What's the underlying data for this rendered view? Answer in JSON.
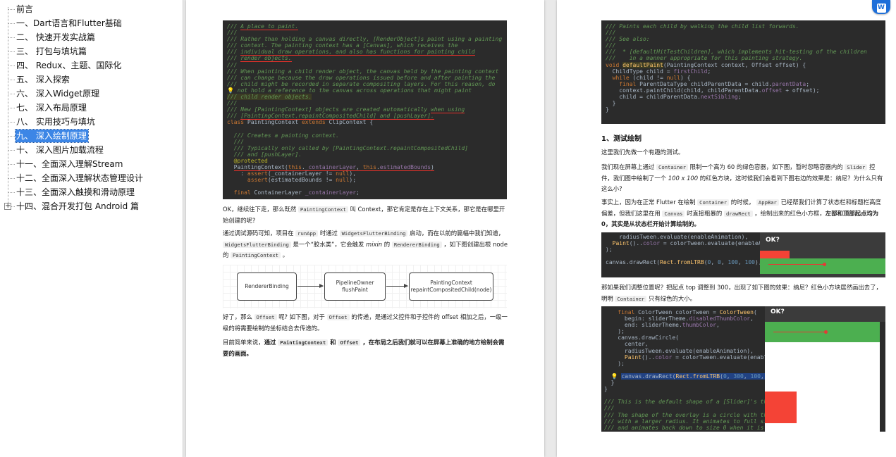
{
  "toc": {
    "items": [
      {
        "label": "前言"
      },
      {
        "label": "一、Dart语言和Flutter基础"
      },
      {
        "label": "二、 快速开发实战篇"
      },
      {
        "label": "三、 打包与填坑篇"
      },
      {
        "label": "四、 Redux、主题、国际化"
      },
      {
        "label": "五、 深入探索"
      },
      {
        "label": "六、 深入Widget原理"
      },
      {
        "label": "七、 深入布局原理"
      },
      {
        "label": "八、 实用技巧与填坑"
      },
      {
        "label": "九、 深入绘制原理"
      },
      {
        "label": "十、 深入图片加载流程"
      },
      {
        "label": "十一、全面深入理解Stream"
      },
      {
        "label": "十二、全面深入理解状态管理设计"
      },
      {
        "label": "十三、全面深入触摸和滑动原理"
      },
      {
        "label": "十四、混合开发打包 Android 篇"
      }
    ],
    "selected_index": 9,
    "expander_symbol": "+"
  },
  "page1": {
    "para1": {
      "a": "OK，继续往下走，那么既然",
      "code1": "PaintingContext",
      "b": "叫 Context，那它肯定是存在上下文关系，那它是在哪里开始创建的呢?"
    },
    "para2": {
      "a": "通过调试源码可知，项目在",
      "code1": "runApp",
      "b": "时通过",
      "code2": "WidgetsFlutterBinding",
      "c": "启动，而在以前的篇幅中我们知道，",
      "code3": "WidgetsFlutterBinding",
      "d": "是一个“胶水类”，它会触发",
      "em": "mixin",
      "e": "的",
      "code4": "RendererBinding",
      "f": "，如下图创建出根 node 的",
      "code5": "PaintingContext",
      "g": "。"
    },
    "diagram": {
      "box1": "RendererBinding",
      "box2_line1": "PipelineOwner",
      "box2_line2": "flushPaint",
      "box3_line1": "PaintingContext",
      "box3_line2": "repaintCompositedChild(node)"
    },
    "para3": {
      "a": "好了，那么",
      "code1": "Offset",
      "b": "呢? 如下图，对于",
      "code2": "Offset",
      "c": "的传递，是通过父控件和子控件的 offset 相加之后，一级一级的将需要绘制的坐标结合去传递的。"
    },
    "para4": {
      "a": "目前简单来说，",
      "b": "通过",
      "code1": "PaintingContext",
      "c": "和",
      "code2": "Offset",
      "d": "，在布局之后我们就可以在屏幕上准确的地方绘制会需要的画面。"
    }
  },
  "page2": {
    "heading": "1、测试绘制",
    "para1": "这里我们先做一个有趣的测试。",
    "para2": {
      "a": "我们现在屏幕上通过",
      "code1": "Container",
      "b": "限制一个高为 60 的绿色容器，如下图，暂时忽略容器内的",
      "code2": "Slider",
      "c": "控件，我们图中绘制了一个",
      "em": "100 x 100",
      "d": "的红色方块，这时候我们会看到下图右边的效果是：纳尼？为什么只有这么小?"
    },
    "para3": {
      "a": "事实上，因为在正常 Flutter 在绘制",
      "code1": "Container",
      "b": "的时候，",
      "code2": "AppBar",
      "c": "已经帮我们计算了状态栏和标题栏高度偏差，但我们这里在用",
      "code3": "Canvas",
      "d": "时直接粗暴的",
      "code4": "drawRect",
      "e": "，绘制出来的红色小方框，",
      "f": "左部和顶部起点均为0，其实是从状态栏开始计算绘制的。"
    },
    "para4": {
      "a": "那如果我们调整位置呢？把起点 top 调整到 300，出现了如下图的效果：纳尼？红色小方块居然画出去了，明明",
      "code1": "Container",
      "b": "只有绿色的大小。"
    },
    "demo_ok": "OK?"
  },
  "colors": {
    "selection": "#3c86e6",
    "code_bg": "#2b2b2b",
    "annotation_red": "#e8312a",
    "demo_green": "#4caf50",
    "demo_red": "#f44336",
    "word_blue": "#1e6fd9"
  },
  "icons": {
    "word_app": "word-icon",
    "lightbulb": "lightbulb-icon",
    "expander": "plus-box-icon"
  },
  "word_icon_letter": "W"
}
